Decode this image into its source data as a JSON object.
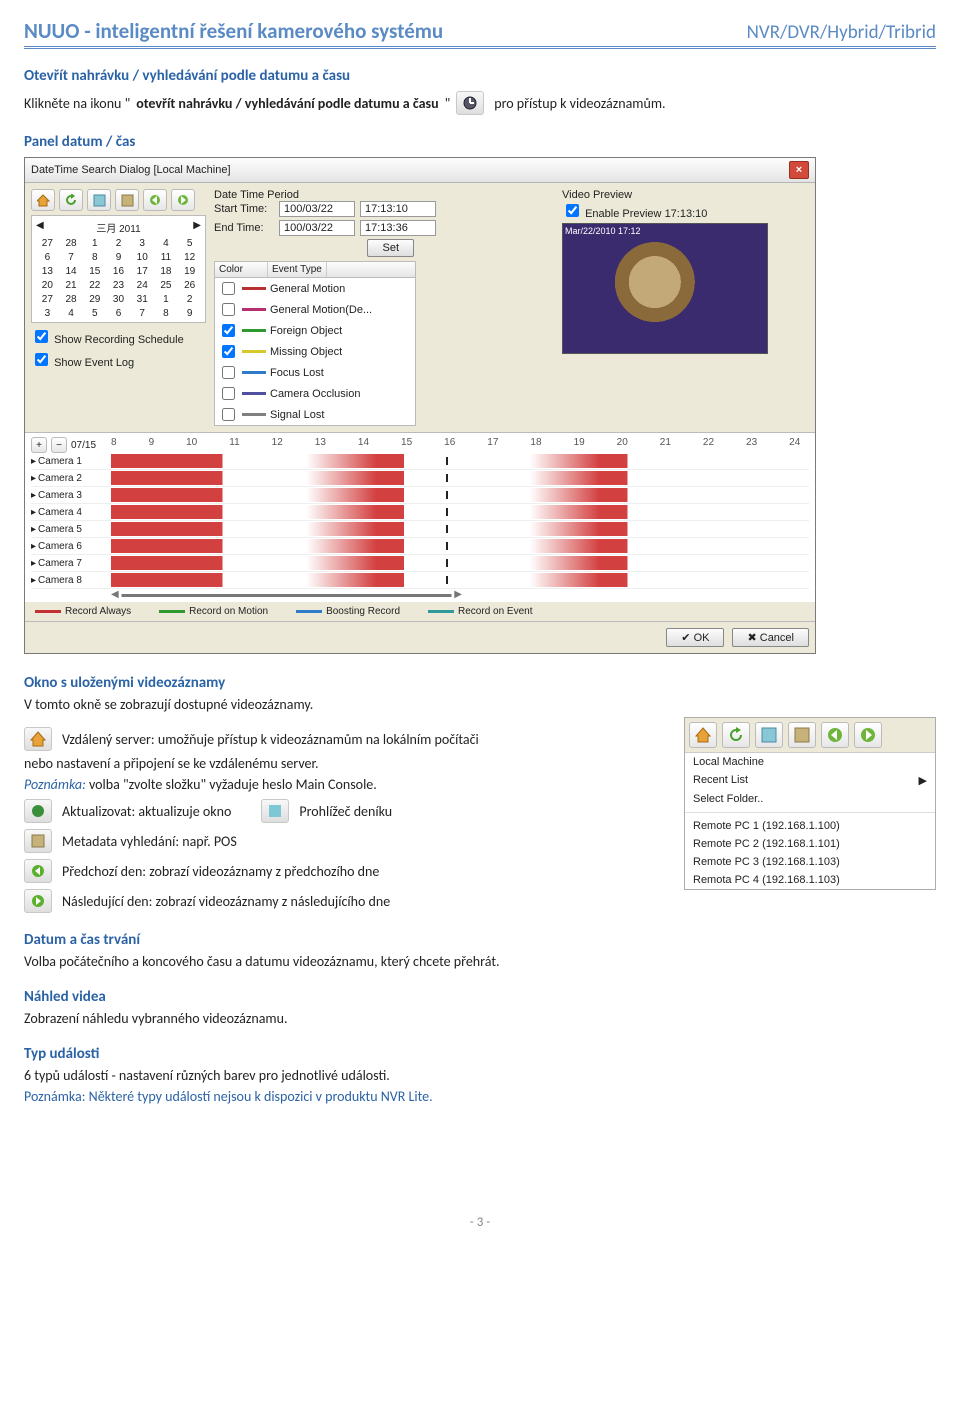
{
  "header": {
    "left": "NUUO - inteligentní řešení kamerového systému",
    "right": "NVR/DVR/Hybrid/Tribrid"
  },
  "s1": {
    "title": "Otevřít nahrávku / vyhledávání podle datumu a času",
    "line_a": "Klikněte na ikonu \"",
    "line_b": "otevřít nahrávku / vyhledávání podle datumu a času",
    "line_c": "\"",
    "line_d": "pro přístup k videozáznamům."
  },
  "panel_title": "Panel datum / čas",
  "dialog": {
    "title": "DateTime Search Dialog  [Local Machine]",
    "period": "Date Time Period",
    "start": "Start Time:",
    "end": "End Time:",
    "date1": "100/03/22",
    "time1": "17:13:10",
    "date2": "100/03/22",
    "time2": "17:13:36",
    "set": "Set",
    "vp": "Video Preview",
    "enable": "Enable Preview",
    "vp_time": "17:13:10",
    "overlay": "Mar/22/2010 17:12",
    "cal_month": "三月 2011",
    "cal_days": [
      "27",
      "28",
      "1",
      "2",
      "3",
      "4",
      "5",
      "6",
      "7",
      "8",
      "9",
      "10",
      "11",
      "12",
      "13",
      "14",
      "15",
      "16",
      "17",
      "18",
      "19",
      "20",
      "21",
      "22",
      "23",
      "24",
      "25",
      "26",
      "27",
      "28",
      "29",
      "30",
      "31",
      "1",
      "2",
      "3",
      "4",
      "5",
      "6",
      "7",
      "8",
      "9"
    ],
    "chk1": "Show Recording Schedule",
    "chk2": "Show Event Log",
    "col": "Color",
    "evt": "Event Type",
    "events": [
      {
        "c": "#b93030",
        "t": "General Motion"
      },
      {
        "c": "#b5306c",
        "t": "General Motion(De..."
      },
      {
        "c": "#2e9a2e",
        "t": "Foreign Object"
      },
      {
        "c": "#d6c92e",
        "t": "Missing Object"
      },
      {
        "c": "#2e7cc9",
        "t": "Focus Lost"
      },
      {
        "c": "#5050a0",
        "t": "Camera Occlusion"
      },
      {
        "c": "#808080",
        "t": "Signal Lost"
      }
    ],
    "tlday": "07/15",
    "hours": [
      "8",
      "9",
      "10",
      "11",
      "12",
      "13",
      "14",
      "15",
      "16",
      "17",
      "18",
      "19",
      "20",
      "21",
      "22",
      "23",
      "24"
    ],
    "cams": [
      "Camera 1",
      "Camera 2",
      "Camera 3",
      "Camera 4",
      "Camera 5",
      "Camera 6",
      "Camera 7",
      "Camera 8"
    ],
    "legend": {
      "ra": "Record Always",
      "rm": "Record on Motion",
      "br": "Boosting Record",
      "re": "Record on Event"
    },
    "ok": "OK",
    "cancel": "Cancel"
  },
  "s2": {
    "title": "Okno s uloženými videozáznamy",
    "line": "V tomto okně se zobrazují dostupné videozáznamy."
  },
  "remote": {
    "a": "Vzdálený server: umožňuje přístup k videozáznamům na lokálním počítači",
    "b": "nebo nastavení a připojení se ke vzdálenému server.",
    "note_l": "Poznámka:",
    "note_r": "volba \"zvolte složku\" vyžaduje heslo Main Console.",
    "upd": "Aktualizovat: aktualizuje okno",
    "log": "Prohlížeč deníku",
    "meta": "Metadata vyhledání: např. POS",
    "prev": "Předchozí den: zobrazí videozáznamy z předchozího dne",
    "next": "Následující den: zobrazí videozáznamy z následujícího dne"
  },
  "menu": {
    "local": "Local Machine",
    "recent": "Recent List",
    "select": "Select Folder..",
    "r1": "Remote PC 1 (192.168.1.100)",
    "r2": "Remote PC 2 (192.168.1.101)",
    "r3": "Remote PC 3 (192.168.1.103)",
    "r4": "Remota PC 4 (192.168.1.103)"
  },
  "s3": {
    "title": "Datum a čas trvání",
    "line": "Volba počátečního a koncového času a datumu videozáznamu, který chcete přehrát."
  },
  "s4": {
    "title": "Náhled videa",
    "line": "Zobrazení náhledu vybranného videozáznamu."
  },
  "s5": {
    "title": "Typ události",
    "line": "6 typů událostí - nastavení různých barev pro jednotlivé události.",
    "note": "Poznámka: Některé typy událostí nejsou k dispozici v produktu NVR Lite."
  },
  "footer": "- 3 -"
}
